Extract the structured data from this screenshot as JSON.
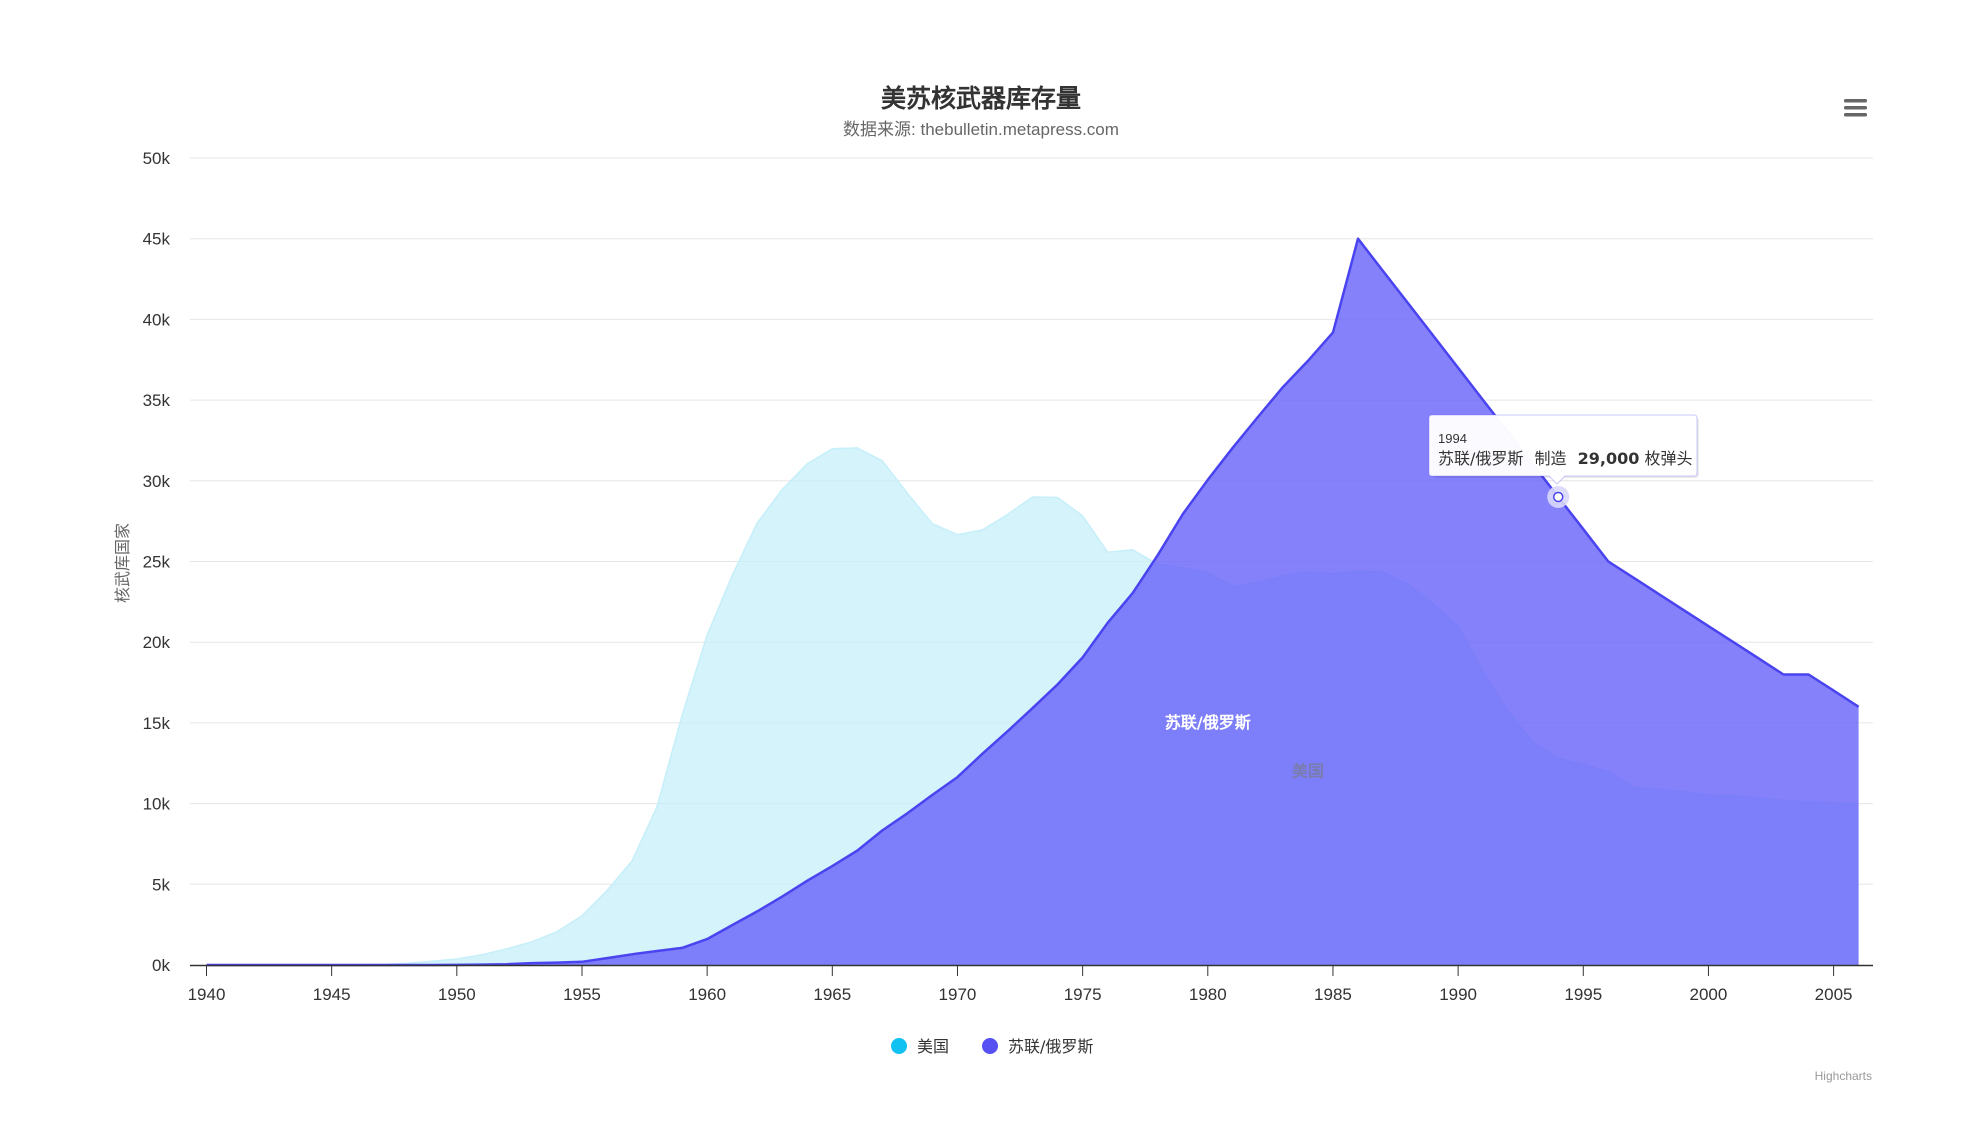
{
  "chart_data": {
    "type": "area",
    "title": "美苏核武器库存量",
    "subtitle": "数据来源: thebulletin.metapress.com",
    "ylabel": "核武库国家",
    "xlabel": "",
    "xlim": [
      1940,
      2006
    ],
    "ylim": [
      0,
      50000
    ],
    "x_ticks": [
      "1940",
      "1945",
      "1950",
      "1955",
      "1960",
      "1965",
      "1970",
      "1975",
      "1980",
      "1985",
      "1990",
      "1995",
      "2000",
      "2005"
    ],
    "y_ticks": [
      "0k",
      "5k",
      "10k",
      "15k",
      "20k",
      "25k",
      "30k",
      "35k",
      "40k",
      "45k",
      "50k"
    ],
    "grid": true,
    "legend_position": "bottom-center",
    "series": [
      {
        "name": "美国",
        "color": "#c6effa",
        "legend_color": "#10c1f2",
        "label_color": "#7a7cb0",
        "start_year": 1940,
        "values": [
          0,
          0,
          0,
          0,
          0,
          6,
          11,
          32,
          110,
          235,
          369,
          640,
          1005,
          1436,
          2063,
          3057,
          4618,
          6444,
          9822,
          15468,
          20434,
          24126,
          27387,
          29459,
          31056,
          31982,
          32040,
          31233,
          29224,
          27342,
          26662,
          26956,
          27912,
          28999,
          28965,
          27826,
          25579,
          25722,
          24826,
          24605,
          24304,
          23464,
          23708,
          24099,
          24357,
          24237,
          24401,
          24344,
          23586,
          22380,
          21004,
          18146,
          15697,
          13785,
          12804,
          12424,
          11985,
          11021,
          10875,
          10734,
          10545,
          10497,
          10342,
          10199,
          10103,
          10057,
          10000
        ]
      },
      {
        "name": "苏联/俄罗斯",
        "color": "#6a65f9",
        "legend_color": "#5750f3",
        "label_color": "#ffffff",
        "start_year": 1940,
        "values": [
          0,
          0,
          0,
          0,
          0,
          0,
          0,
          0,
          0,
          0,
          5,
          25,
          50,
          120,
          150,
          200,
          426,
          660,
          869,
          1060,
          1605,
          2471,
          3322,
          4238,
          5221,
          6129,
          7089,
          8339,
          9399,
          10538,
          11643,
          13092,
          14478,
          15915,
          17385,
          19055,
          21205,
          23044,
          25393,
          27935,
          30062,
          32049,
          33952,
          35804,
          37431,
          39197,
          45000,
          43000,
          41000,
          39000,
          37000,
          35000,
          33000,
          31000,
          29000,
          27000,
          25000,
          24000,
          23000,
          22000,
          21000,
          20000,
          19000,
          18000,
          18000,
          17000,
          16000
        ]
      }
    ],
    "tooltip": {
      "year": "1994",
      "series": "苏联/俄罗斯",
      "verb": "制造",
      "value_text": "29,000",
      "unit": "枚弹头",
      "value": 29000
    },
    "credits": "Highcharts",
    "menu_icon": "hamburger-menu-icon"
  }
}
